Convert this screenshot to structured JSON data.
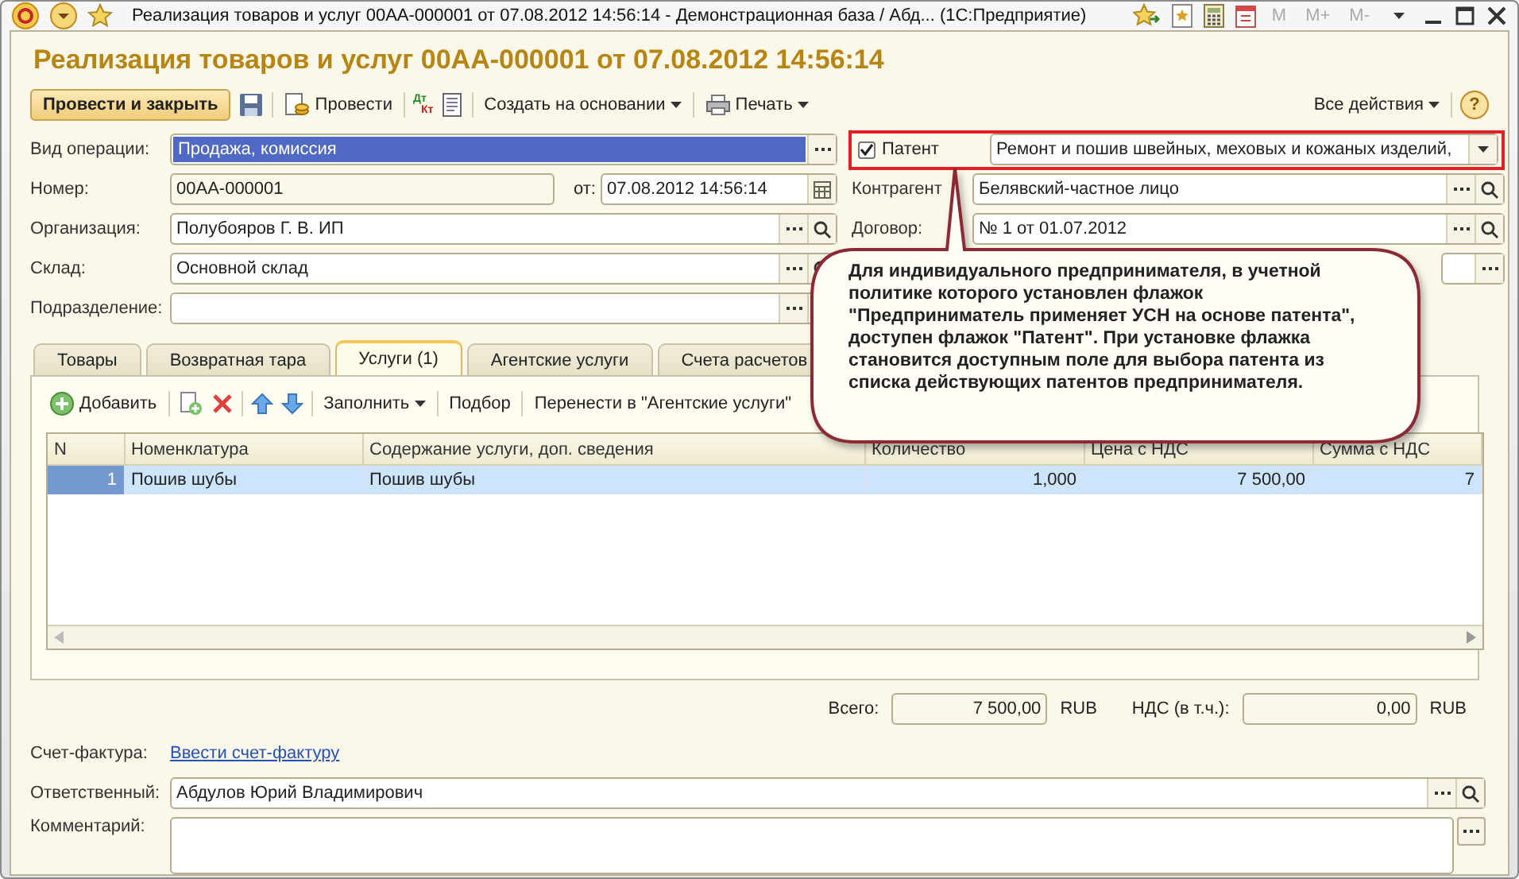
{
  "window": {
    "title": "Реализация товаров и услуг 00АА-000001 от 07.08.2012 14:56:14 - Демонстрационная база / Абд...  (1С:Предприятие)",
    "memory_buttons": [
      "M",
      "M+",
      "M-"
    ]
  },
  "heading": "Реализация товаров и услуг 00АА-000001 от 07.08.2012 14:56:14",
  "toolbar": {
    "post_close": "Провести и закрыть",
    "post": "Провести",
    "dt_kt": [
      "Дт",
      "Кт"
    ],
    "create_based": "Создать на основании",
    "print": "Печать",
    "all_actions": "Все действия",
    "help": "?"
  },
  "form": {
    "operation": {
      "label": "Вид операции:",
      "value": "Продажа, комиссия",
      "selected": true
    },
    "patent": {
      "label": "Патент",
      "checked": true,
      "value": "Ремонт и пошив швейных, меховых и кожаных изделий,"
    },
    "number": {
      "label": "Номер:",
      "value": "00АА-000001"
    },
    "date": {
      "label": "от:",
      "value": "07.08.2012 14:56:14"
    },
    "counterparty": {
      "label": "Контрагент",
      "value": "Белявский-частное лицо"
    },
    "organization": {
      "label": "Организация:",
      "value": "Полубояров Г. В. ИП"
    },
    "contract": {
      "label": "Договор:",
      "value": "№ 1 от 01.07.2012"
    },
    "warehouse": {
      "label": "Склад:",
      "value": "Основной склад"
    },
    "department": {
      "label": "Подразделение:"
    }
  },
  "tabs": [
    {
      "label": "Товары",
      "selected": false
    },
    {
      "label": "Возвратная тара",
      "selected": false
    },
    {
      "label": "Услуги (1)",
      "selected": true
    },
    {
      "label": "Агентские услуги",
      "selected": false
    },
    {
      "label": "Счета расчетов",
      "selected": false
    }
  ],
  "table_toolbar": {
    "add": "Добавить",
    "fill": "Заполнить",
    "pick": "Подбор",
    "move": "Перенести в \"Агентские услуги\""
  },
  "table": {
    "columns": [
      "N",
      "Номенклатура",
      "Содержание услуги, доп. сведения",
      "Количество",
      "Цена с НДС",
      "Сумма с НДС"
    ],
    "rows": [
      {
        "cells": [
          "1",
          "Пошив шубы",
          "Пошив шубы",
          "1,000",
          "7 500,00",
          "7"
        ],
        "selected": true
      }
    ]
  },
  "totals": {
    "total_label": "Всего:",
    "total": "7 500,00",
    "total_currency": "RUB",
    "vat_label": "НДС (в т.ч.):",
    "vat": "0,00",
    "vat_currency": "RUB"
  },
  "invoice": {
    "label": "Счет-фактура:",
    "link": "Ввести счет-фактуру"
  },
  "responsible": {
    "label": "Ответственный:",
    "value": "Абдулов Юрий Владимирович"
  },
  "comment": {
    "label": "Комментарий:"
  },
  "callout": "Для индивидуального предпринимателя, в учетной политике которого установлен флажок \"Предприниматель применяет  УСН на основе патента\",  доступен флажок \"Патент\". При установке флажка становится доступным поле для выбора патента из списка действующих патентов предпринимателя."
}
